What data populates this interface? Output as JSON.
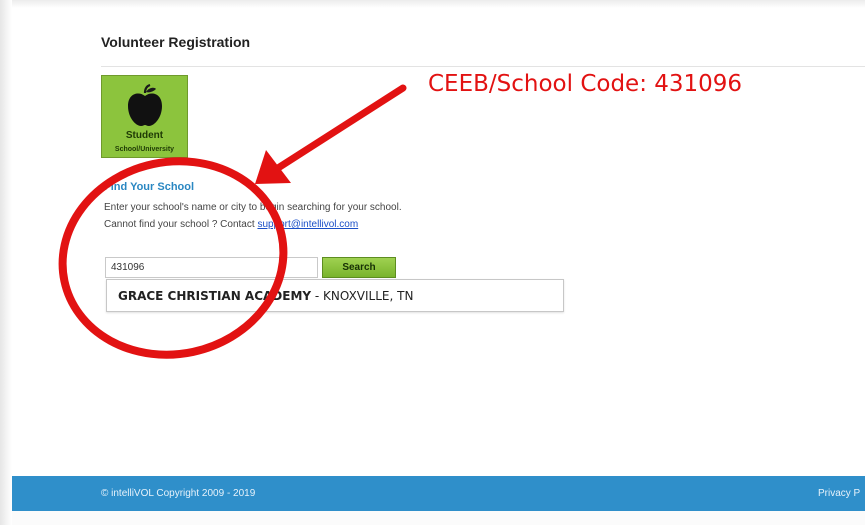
{
  "page": {
    "title": "Volunteer Registration"
  },
  "student_tile": {
    "label": "Student",
    "sublabel": "School/University",
    "icon": "apple-icon"
  },
  "find_school": {
    "title": "Find Your School",
    "instruction_line1": "Enter your school's name or city to begin searching for your school.",
    "instruction_line2_prefix": "Cannot find your school ? Contact ",
    "support_email": "support@intellivol.com"
  },
  "search": {
    "value": "431096",
    "button_label": "Search"
  },
  "results": [
    {
      "name": "GRACE CHRISTIAN ACADEMY",
      "location": " - KNOXVILLE, TN"
    }
  ],
  "annotation": {
    "text": "CEEB/School Code: 431096",
    "color": "#e21212"
  },
  "footer": {
    "copyright": "© intelliVOL Copyright 2009 - 2019",
    "privacy_link": "Privacy P"
  },
  "colors": {
    "accent_green": "#8cc43d",
    "footer_blue": "#2f8fca",
    "link_blue": "#2a87c2"
  }
}
